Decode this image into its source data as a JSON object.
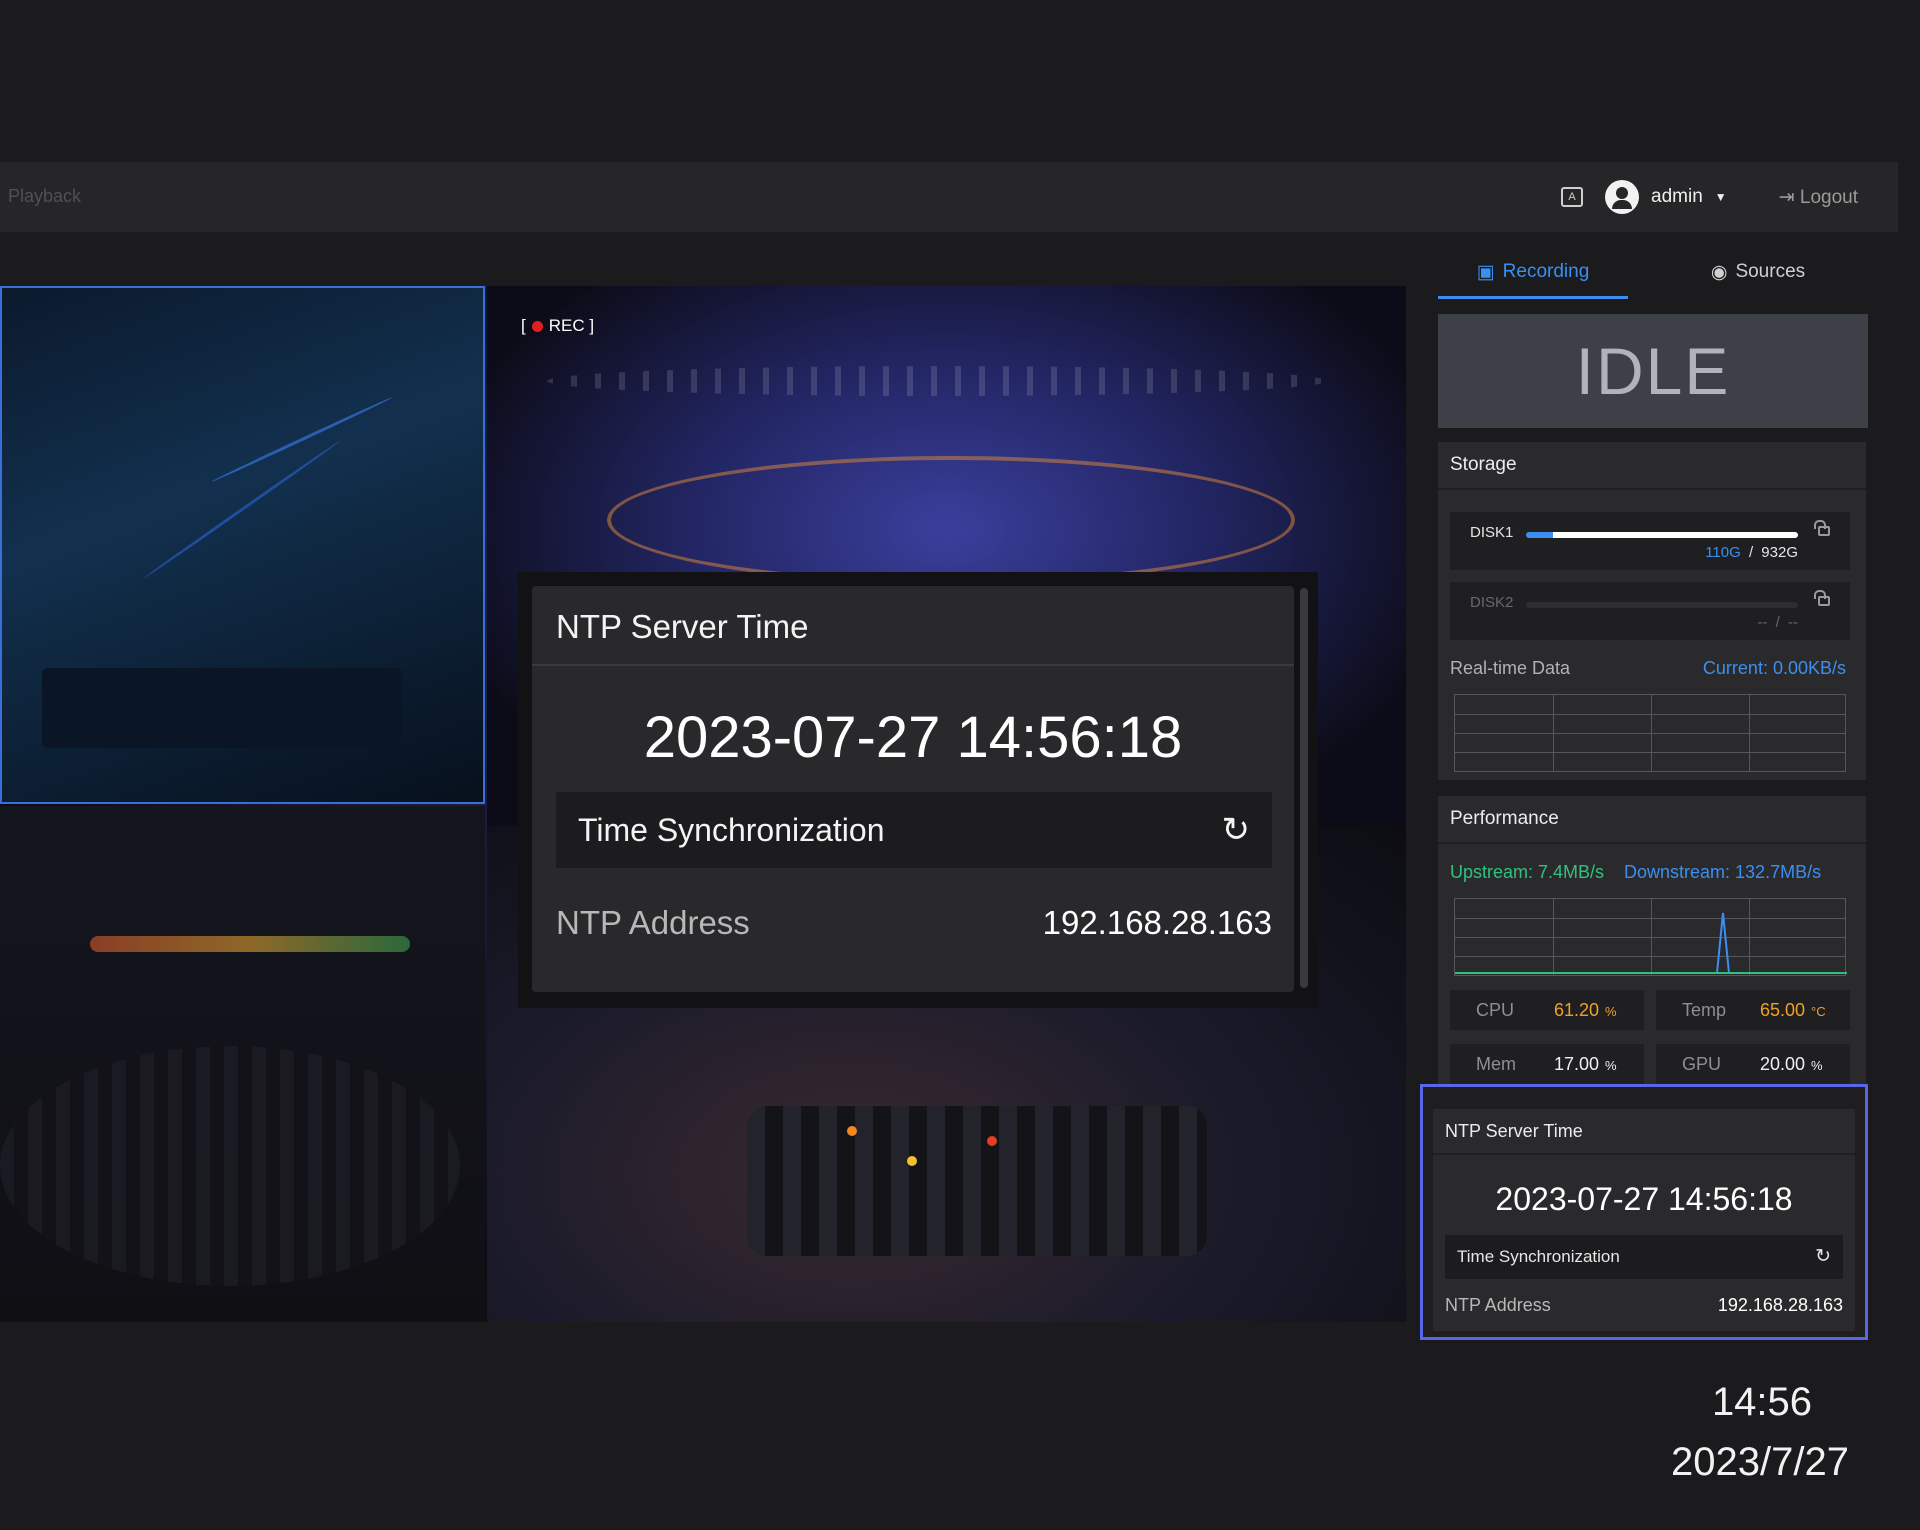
{
  "nav": {
    "playback": "Playback"
  },
  "topbar": {
    "keyboard_icon_label": "A",
    "user": "admin",
    "logout": "Logout"
  },
  "video": {
    "rec_label": "[ ● REC ]",
    "rec_text": "REC ]",
    "rec_prefix": "["
  },
  "popup": {
    "title": "NTP Server Time",
    "time": "2023-07-27 14:56:18",
    "sync_label": "Time Synchronization",
    "address_label": "NTP Address",
    "address_value": "192.168.28.163"
  },
  "sidebar": {
    "tabs": [
      {
        "label": "Recording"
      },
      {
        "label": "Sources"
      }
    ],
    "status": "IDLE",
    "storage": {
      "title": "Storage",
      "disks": [
        {
          "name": "DISK1",
          "used": "110G",
          "total": "932G",
          "sep": "/",
          "fill_fraction": 1.0
        },
        {
          "name": "DISK2",
          "used": "--",
          "total": "--",
          "sep": "/",
          "fill_fraction": 0
        }
      ],
      "realtime_label": "Real-time Data",
      "realtime_current": "Current: 0.00KB/s"
    },
    "performance": {
      "title": "Performance",
      "upstream": "Upstream: 7.4MB/s",
      "downstream": "Downstream: 132.7MB/s",
      "stats": [
        {
          "label": "CPU",
          "value": "61.20",
          "unit": "%",
          "color": "#f0a028"
        },
        {
          "label": "Temp",
          "value": "65.00",
          "unit": "°C",
          "color": "#f0a028"
        },
        {
          "label": "Mem",
          "value": "17.00",
          "unit": "%",
          "color": "#f0f0f0"
        },
        {
          "label": "GPU",
          "value": "20.00",
          "unit": "%",
          "color": "#f0f0f0"
        }
      ]
    },
    "ntp": {
      "title": "NTP Server Time",
      "time": "2023-07-27 14:56:18",
      "sync_label": "Time Synchronization",
      "address_label": "NTP Address",
      "address_value": "192.168.28.163"
    }
  },
  "clock": {
    "time": "14:56",
    "date": "2023/7/27"
  },
  "colors": {
    "accent": "#3b8ff0",
    "upstream": "#2ec27e",
    "highlight": "#5a66e8"
  }
}
